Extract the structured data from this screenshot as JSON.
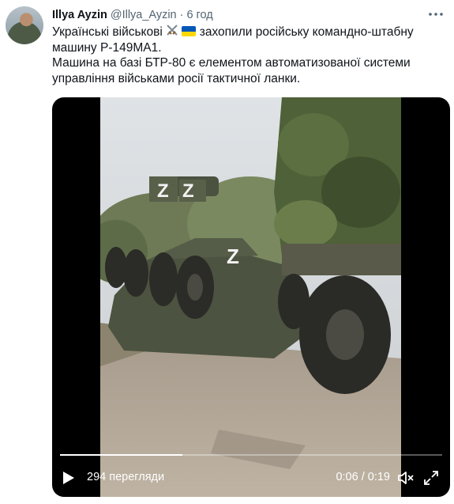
{
  "author": {
    "name": "Illya Ayzin",
    "handle": "@Illya_Ayzin",
    "separator": "·",
    "time": "6 год"
  },
  "more_icon": "more-horizontal-icon",
  "tweet_text": {
    "line1_part1": "Українські військові",
    "line1_part2": "захопили російську командно-штабну машину Р-149МА1.",
    "paragraph2": "Машина на базі БТР-80 є елементом автоматизованої системи управління військами росії тактичної ланки."
  },
  "emoji": [
    "crossed-swords",
    "ukraine-flag"
  ],
  "video": {
    "views": "294 перегляди",
    "timecode": "0:06 / 0:19",
    "progress": 0.32,
    "play_icon": "play-icon",
    "volume_icon": "volume-muted-icon",
    "fullscreen_icon": "fullscreen-icon"
  },
  "colors": {
    "text": "#0f1419",
    "secondary": "#536471",
    "flag_blue": "#0057b7",
    "flag_yellow": "#ffd700"
  }
}
